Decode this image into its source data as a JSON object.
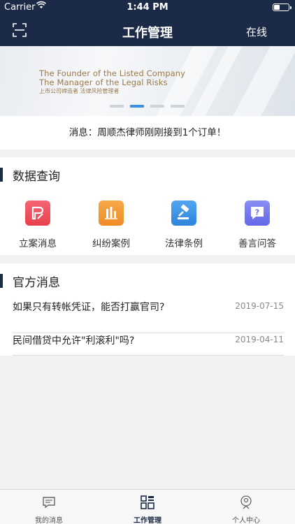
{
  "status_bar": {
    "carrier": "Carrier",
    "time": "1:44 PM"
  },
  "nav": {
    "title": "工作管理",
    "status": "在线",
    "scan_icon": "scan-icon"
  },
  "banner": {
    "line1": "The Founder of the Listed Company",
    "line2": "The Manager of the Legal Risks",
    "line3": "上市公司缔造者  法律风险管理者",
    "active_slide": 2,
    "slide_count": 4
  },
  "notice": {
    "text": "消息：周顺杰律师刚刚接到1个订单！"
  },
  "data_query": {
    "title": "数据查询",
    "items": [
      {
        "label": "立案消息",
        "icon": "case-filing-icon",
        "color": "#ee4f5e"
      },
      {
        "label": "纠纷案例",
        "icon": "dispute-chart-icon",
        "color": "#f59a30"
      },
      {
        "label": "法律条例",
        "icon": "gavel-icon",
        "color": "#3f95e8"
      },
      {
        "label": "善言问答",
        "icon": "question-chat-icon",
        "color": "#7579ee"
      }
    ]
  },
  "official_news": {
    "title": "官方消息",
    "items": [
      {
        "title": "如果只有转帐凭证，能否打赢官司?",
        "date": "2019-07-15"
      },
      {
        "title": "民间借贷中允许\"利滚利\"吗?",
        "date": "2019-04-11"
      }
    ]
  },
  "tabbar": {
    "items": [
      {
        "label": "我的消息",
        "icon": "message-icon"
      },
      {
        "label": "工作管理",
        "icon": "work-grid-icon"
      },
      {
        "label": "个人中心",
        "icon": "user-icon"
      }
    ],
    "active_index": 1
  },
  "colors": {
    "nav_bg": "#1b2a46",
    "accent": "#3d8fe0"
  }
}
